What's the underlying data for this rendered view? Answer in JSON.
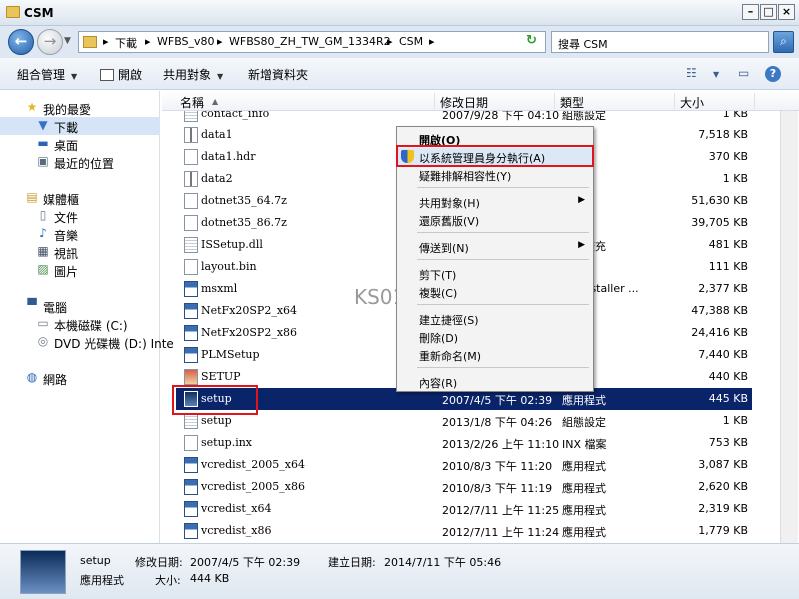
{
  "window": {
    "title": "CSM"
  },
  "address": {
    "breadcrumbs": [
      "下載",
      "WFBS_v80",
      "WFBS80_ZH_TW_GM_1334R2",
      "CSM"
    ],
    "search_placeholder": "搜尋 CSM"
  },
  "toolbar": {
    "organize": "組合管理",
    "open": "開啟",
    "share": "共用對象",
    "new_folder": "新增資料夾"
  },
  "nav": {
    "favorites": "我的最愛",
    "downloads": "下載",
    "desktop": "桌面",
    "recent": "最近的位置",
    "libraries": "媒體櫃",
    "documents": "文件",
    "music": "音樂",
    "videos": "視訊",
    "pictures": "圖片",
    "computer": "電腦",
    "local_disk": "本機磁碟 (C:)",
    "dvd": "DVD 光碟機 (D:) Inte",
    "network": "網路"
  },
  "columns": {
    "name": "名稱",
    "date": "修改日期",
    "type": "類型",
    "size": "大小"
  },
  "files": [
    {
      "name": "contact_info",
      "date": "2007/9/28 下午 04:10",
      "type": "組態設定",
      "size": "1 KB",
      "icon": "cfg"
    },
    {
      "name": "data1",
      "date": "",
      "type": "",
      "size": "7,518 KB",
      "icon": "zip"
    },
    {
      "name": "data1.hdr",
      "date": "",
      "type": "",
      "size": "370 KB",
      "icon": "doc"
    },
    {
      "name": "data2",
      "date": "",
      "type": "",
      "size": "1 KB",
      "icon": "zip"
    },
    {
      "name": "dotnet35_64.7z",
      "date": "",
      "type": "",
      "size": "51,630 KB",
      "icon": "doc"
    },
    {
      "name": "dotnet35_86.7z",
      "date": "",
      "type": "",
      "size": "39,705 KB",
      "icon": "doc"
    },
    {
      "name": "ISSetup.dll",
      "date": "",
      "type": "",
      "size": "481 KB",
      "icon": "cfg"
    },
    {
      "name": "layout.bin",
      "date": "",
      "type": "",
      "size": "111 KB",
      "icon": "doc"
    },
    {
      "name": "msxml",
      "date": "",
      "type": "",
      "size": "2,377 KB",
      "icon": "exe"
    },
    {
      "name": "NetFx20SP2_x64",
      "date": "",
      "type": "",
      "size": "47,388 KB",
      "icon": "exe"
    },
    {
      "name": "NetFx20SP2_x86",
      "date": "",
      "type": "",
      "size": "24,416 KB",
      "icon": "exe"
    },
    {
      "name": "PLMSetup",
      "date": "",
      "type": "",
      "size": "7,440 KB",
      "icon": "exe"
    },
    {
      "name": "SETUP",
      "date": "",
      "type": "",
      "size": "440 KB",
      "icon": "doc"
    },
    {
      "name": "setup",
      "date": "2007/4/5 下午 02:39",
      "type": "應用程式",
      "size": "445 KB",
      "icon": "sel"
    },
    {
      "name": "setup",
      "date": "2013/1/8 下午 04:26",
      "type": "組態設定",
      "size": "1 KB",
      "icon": "cfg"
    },
    {
      "name": "setup.inx",
      "date": "2013/2/26 上午 11:10",
      "type": "INX 檔案",
      "size": "753 KB",
      "icon": "doc"
    },
    {
      "name": "vcredist_2005_x64",
      "date": "2010/8/3 下午 11:20",
      "type": "應用程式",
      "size": "3,087 KB",
      "icon": "exe"
    },
    {
      "name": "vcredist_2005_x86",
      "date": "2010/8/3 下午 11:19",
      "type": "應用程式",
      "size": "2,620 KB",
      "icon": "exe"
    },
    {
      "name": "vcredist_x64",
      "date": "2012/7/11 上午 11:25",
      "type": "應用程式",
      "size": "2,319 KB",
      "icon": "exe"
    },
    {
      "name": "vcredist_x86",
      "date": "2012/7/11 上午 11:24",
      "type": "應用程式",
      "size": "1,779 KB",
      "icon": "exe"
    }
  ],
  "hidden_types": {
    "data1": "緒",
    "data1_hdr": "檔案",
    "data2": "緒",
    "dotnet64": "案",
    "dotnet86": "案",
    "issetup": "程式擴充",
    "layout": "檔案",
    "msxml": "ws Installer ...",
    "netfx64": "程式",
    "netfx86": "程式",
    "plm": "程式",
    "setupimg": "影像"
  },
  "context_menu": {
    "open": "開啟(O)",
    "run_as_admin": "以系統管理員身分執行(A)",
    "troubleshoot": "疑難排解相容性(Y)",
    "share_with": "共用對象(H)",
    "restore_prev": "還原舊版(V)",
    "send_to": "傳送到(N)",
    "cut": "剪下(T)",
    "copy": "複製(C)",
    "create_shortcut": "建立捷徑(S)",
    "delete": "刪除(D)",
    "rename": "重新命名(M)",
    "properties": "內容(R)"
  },
  "watermark": "KS0105",
  "details": {
    "name": "setup",
    "type": "應用程式",
    "modified_label": "修改日期:",
    "modified_value": "2007/4/5 下午 02:39",
    "size_label": "大小:",
    "size_value": "444 KB",
    "created_label": "建立日期:",
    "created_value": "2014/7/11 下午 05:46"
  }
}
